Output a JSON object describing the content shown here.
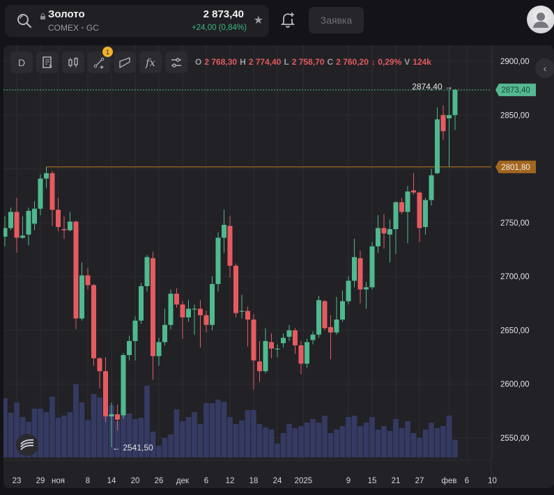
{
  "header": {
    "instrument_name": "Золото",
    "exchange": "COMEX",
    "ticker": "GC",
    "separator": "•",
    "price": "2 873,40",
    "change": "+24,00 (0,84%)",
    "order_button": "Заявка"
  },
  "toolbar": {
    "interval": "D",
    "fx_label": "fx",
    "drawings_badge": "1"
  },
  "ohlc": {
    "o_label": "O",
    "o": "2 768,30",
    "h_label": "H",
    "h": "2 774,40",
    "l_label": "L",
    "l": "2 758,70",
    "c_label": "C",
    "c": "2 760,20",
    "change": "↓ 0,29%",
    "v_label": "V",
    "v": "124k"
  },
  "colors": {
    "up": "#4fb98f",
    "down": "#e65b60",
    "volume": "#353a63",
    "level": "#c0741d",
    "level_tag": "#a3661f",
    "last_tag": "#55b892"
  },
  "chart_data": {
    "type": "candlestick",
    "y_ticks": [
      "2900,00",
      "2850,00",
      "2800,00",
      "2750,00",
      "2700,00",
      "2650,00",
      "2600,00",
      "2550,00"
    ],
    "y_tick_values": [
      2900,
      2850,
      2800,
      2750,
      2700,
      2650,
      2600,
      2550
    ],
    "ylim": [
      2513,
      2922
    ],
    "last_price_label": "2873,40",
    "last_price": 2873.4,
    "level_label": "2801,80",
    "level": 2801.8,
    "high_marker": "2874,40 →",
    "high_value": 2874.4,
    "high_index": 77,
    "low_marker": "← 2541,50",
    "low_value": 2541.5,
    "low_index": 19,
    "level_start_index": 8,
    "x_labels": [
      {
        "t": "23",
        "i": 3
      },
      {
        "t": "29",
        "i": 7
      },
      {
        "t": "ноя",
        "i": 10
      },
      {
        "t": "8",
        "i": 15
      },
      {
        "t": "14",
        "i": 19
      },
      {
        "t": "20",
        "i": 23
      },
      {
        "t": "26",
        "i": 27
      },
      {
        "t": "дек",
        "i": 31
      },
      {
        "t": "6",
        "i": 35
      },
      {
        "t": "12",
        "i": 39
      },
      {
        "t": "18",
        "i": 43
      },
      {
        "t": "24",
        "i": 47
      },
      {
        "t": "2025",
        "i": 51.4
      },
      {
        "t": "9",
        "i": 59
      },
      {
        "t": "15",
        "i": 63
      },
      {
        "t": "21",
        "i": 67
      },
      {
        "t": "27",
        "i": 71
      },
      {
        "t": "фев",
        "i": 76
      },
      {
        "t": "6",
        "i": 79
      },
      {
        "t": "10",
        "i": 83.3
      }
    ],
    "candles": [
      [
        2737,
        2756,
        2728,
        2745,
        85
      ],
      [
        2745,
        2764,
        2743,
        2760,
        64
      ],
      [
        2760,
        2773,
        2722,
        2736,
        79
      ],
      [
        2736,
        2756,
        2735,
        2738,
        58
      ],
      [
        2739,
        2764,
        2729,
        2761,
        51
      ],
      [
        2749,
        2770,
        2743,
        2763,
        70
      ],
      [
        2763,
        2795,
        2757,
        2791,
        70
      ],
      [
        2791,
        2802,
        2782,
        2796,
        65
      ],
      [
        2796,
        2798,
        2747,
        2762,
        87
      ],
      [
        2762,
        2773,
        2742,
        2746,
        57
      ],
      [
        2744,
        2756,
        2735,
        2743,
        60
      ],
      [
        2743,
        2760,
        2742,
        2751,
        65
      ],
      [
        2751,
        2752,
        2651,
        2661,
        105
      ],
      [
        2661,
        2713,
        2659,
        2701,
        79
      ],
      [
        2701,
        2708,
        2688,
        2692,
        54
      ],
      [
        2692,
        2693,
        2617,
        2624,
        91
      ],
      [
        2624,
        2625,
        2596,
        2612,
        86
      ],
      [
        2612,
        2625,
        2565,
        2570,
        73
      ],
      [
        2570,
        2583,
        2541.5,
        2572,
        75
      ],
      [
        2572,
        2581,
        2557,
        2567,
        52
      ],
      [
        2571,
        2629,
        2568,
        2627,
        73
      ],
      [
        2627,
        2645,
        2622,
        2640,
        63
      ],
      [
        2640,
        2663,
        2622,
        2659,
        55
      ],
      [
        2659,
        2694,
        2656,
        2691,
        57
      ],
      [
        2691,
        2720,
        2686,
        2718,
        103
      ],
      [
        2717,
        2723,
        2604,
        2626,
        37
      ],
      [
        2626,
        2643,
        2617,
        2639,
        17
      ],
      [
        2639,
        2670,
        2636,
        2655,
        28
      ],
      [
        2655,
        2688,
        2651,
        2684,
        33
      ],
      [
        2684,
        2689,
        2671,
        2674,
        69
      ],
      [
        2674,
        2677,
        2642,
        2662,
        52
      ],
      [
        2662,
        2678,
        2658,
        2670,
        58
      ],
      [
        2670,
        2674,
        2646,
        2670,
        65
      ],
      [
        2670,
        2678,
        2634,
        2664,
        48
      ],
      [
        2664,
        2668,
        2648,
        2655,
        78
      ],
      [
        2655,
        2700,
        2650,
        2693,
        78
      ],
      [
        2693,
        2741,
        2686,
        2736,
        83
      ],
      [
        2736,
        2762,
        2722,
        2748,
        80
      ],
      [
        2747,
        2756,
        2699,
        2710,
        58
      ],
      [
        2710,
        2712,
        2662,
        2666,
        48
      ],
      [
        2668,
        2683,
        2661,
        2668,
        53
      ],
      [
        2668,
        2672,
        2635,
        2660,
        68
      ],
      [
        2660,
        2665,
        2595,
        2622,
        68
      ],
      [
        2621,
        2640,
        2602,
        2612,
        48
      ],
      [
        2612,
        2652,
        2610,
        2640,
        43
      ],
      [
        2639,
        2647,
        2624,
        2633,
        40
      ],
      [
        2633,
        2637,
        2625,
        2633,
        20
      ],
      [
        2638,
        2647,
        2634,
        2643,
        35
      ],
      [
        2644,
        2655,
        2640,
        2650,
        48
      ],
      [
        2650,
        2652,
        2628,
        2636,
        42
      ],
      [
        2636,
        2640,
        2609,
        2619,
        45
      ],
      [
        2619,
        2642,
        2615,
        2639,
        50
      ],
      [
        2641,
        2649,
        2637,
        2646,
        55
      ],
      [
        2646,
        2682,
        2643,
        2678,
        50
      ],
      [
        2677,
        2678,
        2650,
        2652,
        60
      ],
      [
        2653,
        2664,
        2623,
        2648,
        35
      ],
      [
        2648,
        2681,
        2646,
        2660,
        40
      ],
      [
        2660,
        2687,
        2658,
        2677,
        45
      ],
      [
        2677,
        2700,
        2674,
        2696,
        58
      ],
      [
        2696,
        2735,
        2690,
        2718,
        60
      ],
      [
        2717,
        2724,
        2675,
        2688,
        45
      ],
      [
        2688,
        2695,
        2670,
        2690,
        50
      ],
      [
        2690,
        2732,
        2688,
        2728,
        58
      ],
      [
        2728,
        2757,
        2722,
        2745,
        40
      ],
      [
        2745,
        2758,
        2726,
        2740,
        45
      ],
      [
        2739,
        2753,
        2713,
        2744,
        38
      ],
      [
        2744,
        2770,
        2721,
        2769,
        55
      ],
      [
        2769,
        2773,
        2758,
        2760,
        42
      ],
      [
        2760,
        2784,
        2731,
        2779,
        52
      ],
      [
        2780,
        2796,
        2776,
        2778,
        35
      ],
      [
        2778,
        2779,
        2732,
        2745,
        28
      ],
      [
        2746,
        2773,
        2739,
        2771,
        40
      ],
      [
        2771,
        2800,
        2766,
        2794,
        50
      ],
      [
        2796,
        2857,
        2795,
        2846,
        42
      ],
      [
        2850,
        2859,
        2827,
        2835,
        45
      ],
      [
        2847,
        2874,
        2802,
        2850,
        60
      ],
      [
        2850,
        2874.4,
        2836,
        2873.4,
        25
      ]
    ]
  }
}
